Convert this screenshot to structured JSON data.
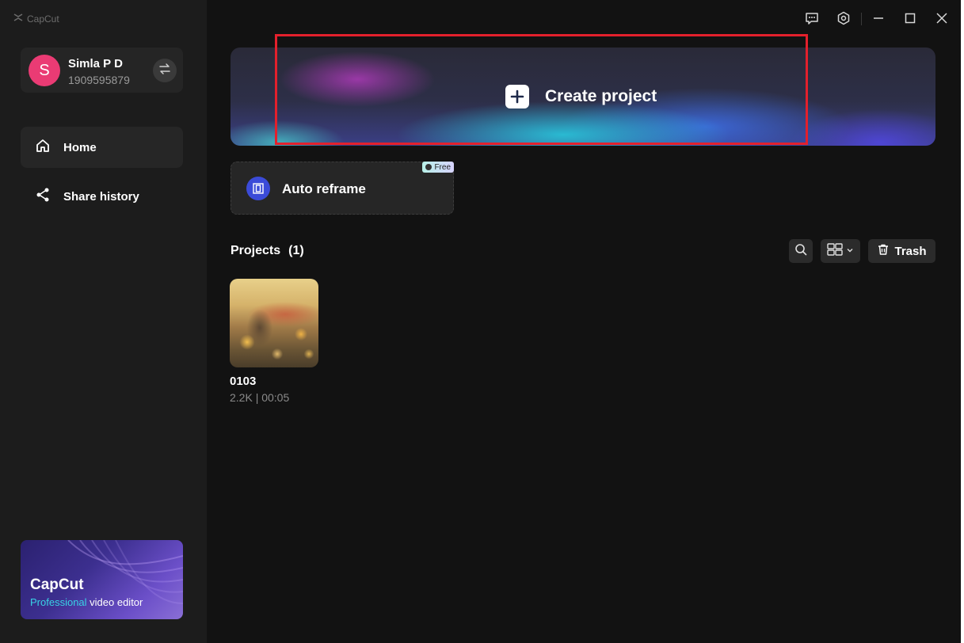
{
  "app": {
    "brand": "CapCut"
  },
  "account": {
    "avatar_letter": "S",
    "name": "Simla P D",
    "id": "1909595879"
  },
  "nav": {
    "home": "Home",
    "share_history": "Share history"
  },
  "promo": {
    "title": "CapCut",
    "subtitle_accent": "Professional",
    "subtitle_rest": " video editor"
  },
  "main": {
    "create_project": "Create project",
    "auto_reframe": "Auto reframe",
    "free_badge": "Free",
    "projects_label": "Projects",
    "projects_count": "(1)",
    "trash_label": "Trash"
  },
  "projects": [
    {
      "name": "0103",
      "meta": "2.2K | 00:05"
    }
  ],
  "icons": {
    "brand": "capcut-logo-icon",
    "switch": "switch-account-icon",
    "home": "home-icon",
    "share": "share-icon",
    "feedback": "feedback-icon",
    "settings": "settings-icon",
    "minimize": "minimize-icon",
    "maximize": "maximize-icon",
    "close": "close-icon",
    "plus": "plus-icon",
    "reframe": "reframe-icon",
    "search": "search-icon",
    "view": "grid-view-icon",
    "trash": "trash-icon"
  },
  "colors": {
    "avatar": "#ea3b74",
    "highlight": "#e3202c",
    "reframe_icon": "#3b4bd8",
    "promo_accent": "#39d3e6"
  }
}
